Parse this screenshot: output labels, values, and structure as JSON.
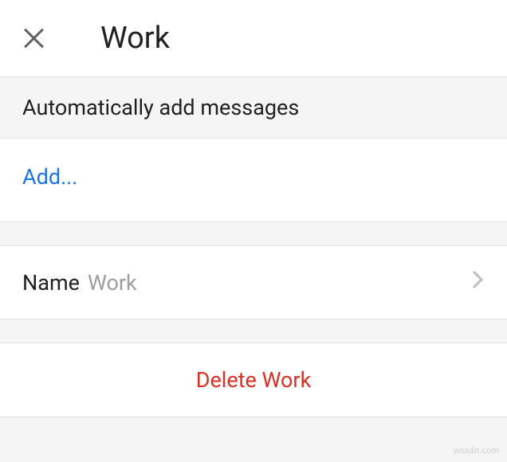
{
  "header": {
    "title": "Work"
  },
  "sections": {
    "auto_add_header": "Automatically add messages",
    "add_link": "Add...",
    "name": {
      "label": "Name",
      "value": "Work"
    },
    "delete_label": "Delete Work"
  },
  "watermark": "wsxdn.com"
}
